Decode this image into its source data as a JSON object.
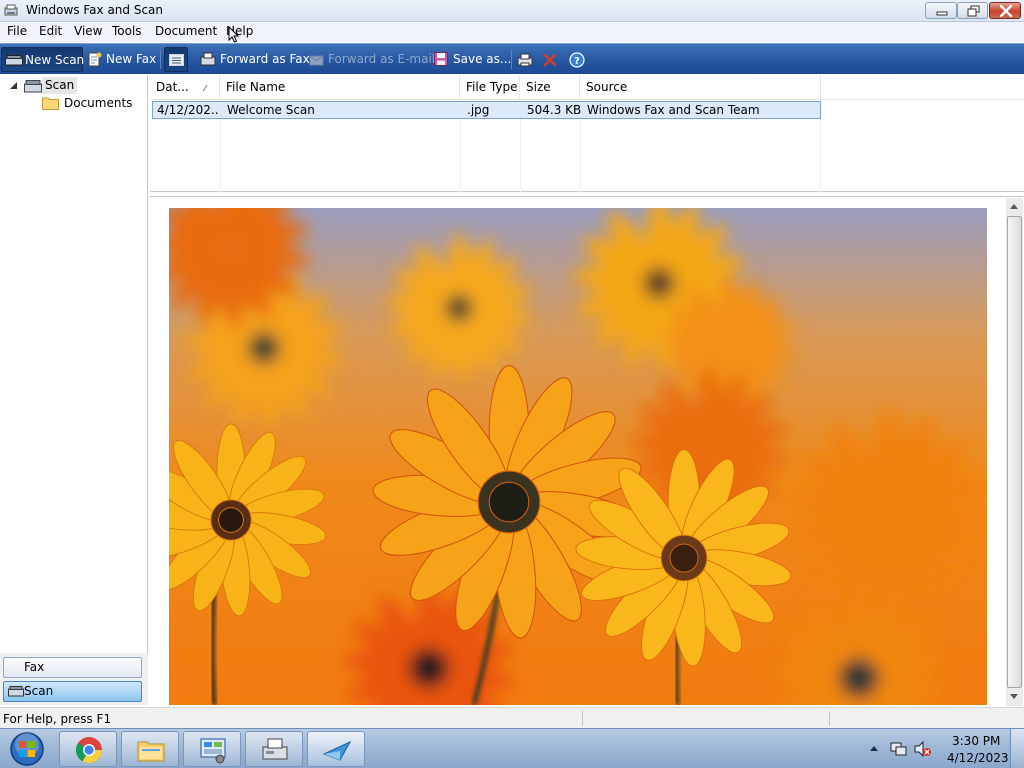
{
  "window": {
    "title": "Windows Fax and Scan"
  },
  "menu": [
    "File",
    "Edit",
    "View",
    "Tools",
    "Document",
    "Help"
  ],
  "toolbar": {
    "new_scan": "New Scan",
    "new_fax": "New Fax",
    "forward_fax": "Forward as Fax",
    "forward_email": "Forward as E-mail",
    "save_as": "Save as..."
  },
  "tree": {
    "root": "Scan",
    "child": "Documents"
  },
  "nav": {
    "fax": "Fax",
    "scan": "Scan"
  },
  "list": {
    "columns": [
      "Dat...",
      "File Name",
      "File Type",
      "Size",
      "Source"
    ],
    "rows": [
      {
        "date": "4/12/202...",
        "name": "Welcome Scan",
        "type": ".jpg",
        "size": "504.3 KB",
        "source": "Windows Fax and Scan Team"
      }
    ]
  },
  "status": {
    "text": "For Help, press F1"
  },
  "taskbar": {
    "apps": [
      "start-orb-icon",
      "chrome-icon",
      "file-explorer-icon",
      "control-panel-icon",
      "fax-printer-icon",
      "fax-scan-app-icon"
    ],
    "time": "3:30 PM",
    "date": "4/12/2023"
  },
  "colors": {
    "toolbar": "#2859a3",
    "selection": "#dbe9f8",
    "close_button": "#c8422b"
  }
}
